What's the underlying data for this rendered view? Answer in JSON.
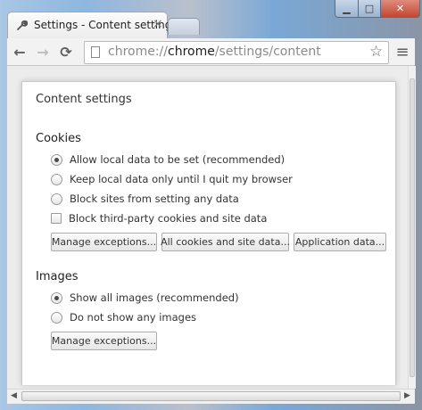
{
  "window": {
    "minimize_glyph": "▁",
    "maximize_glyph": "□",
    "close_glyph": "✕"
  },
  "tab": {
    "title": "Settings - Content settings",
    "close_glyph": "×",
    "icon": "wrench-icon"
  },
  "toolbar": {
    "back_icon": "←",
    "forward_icon": "→",
    "reload_icon": "⟳",
    "url_prefix": "chrome://",
    "url_host": "chrome",
    "url_path": "/settings/content",
    "star_icon": "☆",
    "menu_icon": "≡"
  },
  "page": {
    "title": "Content settings",
    "cookies": {
      "heading": "Cookies",
      "options": [
        {
          "label": "Allow local data to be set (recommended)",
          "selected": true
        },
        {
          "label": "Keep local data only until I quit my browser",
          "selected": false
        },
        {
          "label": "Block sites from setting any data",
          "selected": false
        }
      ],
      "block_third_party": {
        "label": "Block third-party cookies and site data",
        "checked": false
      },
      "buttons": {
        "manage_exceptions": "Manage exceptions...",
        "all_cookies": "All cookies and site data...",
        "application_data": "Application data..."
      }
    },
    "images": {
      "heading": "Images",
      "options": [
        {
          "label": "Show all images (recommended)",
          "selected": true
        },
        {
          "label": "Do not show any images",
          "selected": false
        }
      ],
      "buttons": {
        "manage_exceptions": "Manage exceptions..."
      }
    }
  },
  "colors": {
    "accent": "#4a4a4a",
    "close_button": "#c24733"
  }
}
